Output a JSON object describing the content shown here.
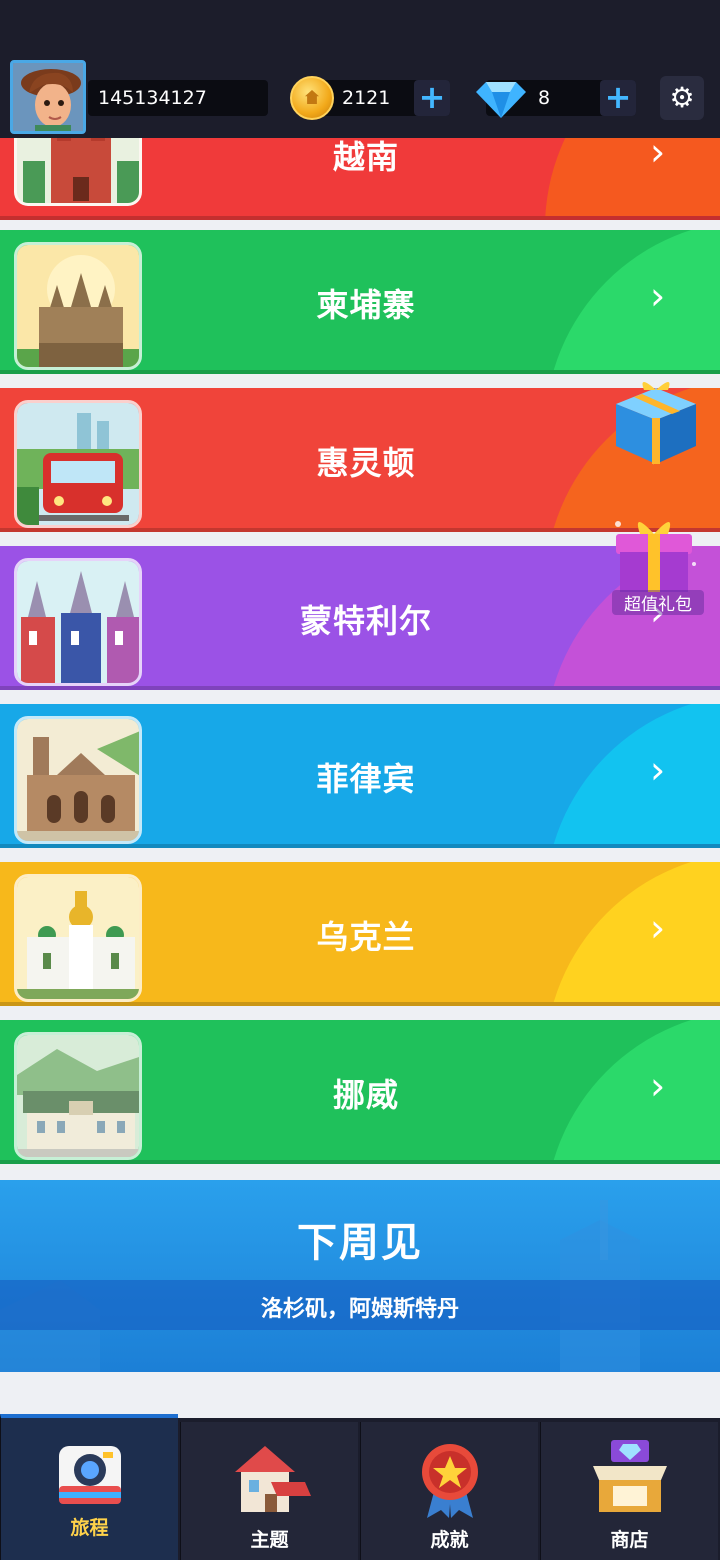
{
  "header": {
    "player_id": "145134127",
    "coins": "2121",
    "gems": "8",
    "coin_plus": "+",
    "gem_plus": "+",
    "settings_icon": "gear-icon"
  },
  "destinations": [
    {
      "name": "越南",
      "color": "#f03a3a"
    },
    {
      "name": "柬埔寨",
      "color": "#1fc15b"
    },
    {
      "name": "惠灵顿",
      "color": "#f0443a"
    },
    {
      "name": "蒙特利尔",
      "color": "#9b52e6"
    },
    {
      "name": "菲律宾",
      "color": "#17a8e8"
    },
    {
      "name": "乌克兰",
      "color": "#f7b81b"
    },
    {
      "name": "挪威",
      "color": "#1fc15b"
    }
  ],
  "chevron": "›",
  "next_week": {
    "title": "下周见",
    "subtitle": "洛杉矶，阿姆斯特丹"
  },
  "gift_label": "超值礼包",
  "nav": {
    "journey": "旅程",
    "theme": "主题",
    "achievement": "成就",
    "shop": "商店"
  }
}
